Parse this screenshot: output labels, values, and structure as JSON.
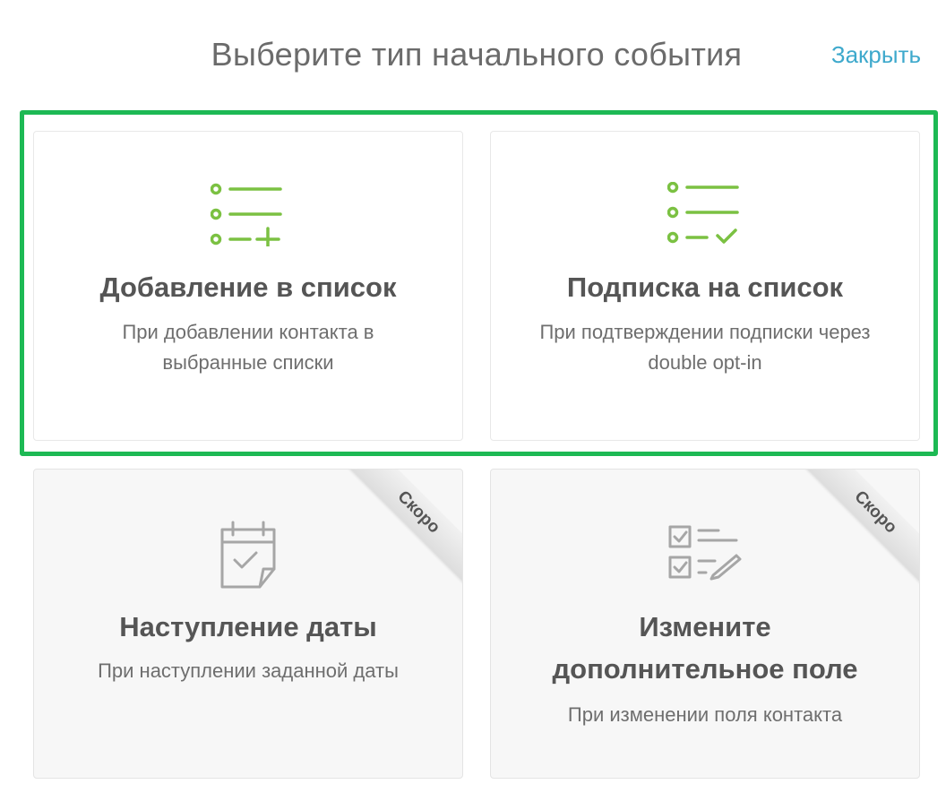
{
  "header": {
    "title": "Выберите тип начального события",
    "close_label": "Закрыть"
  },
  "colors": {
    "accent_green": "#1db954",
    "icon_green": "#7bc142",
    "link_blue": "#3ea9cc",
    "disabled_icon": "#a6a6a6"
  },
  "cards": [
    {
      "title": "Добавление в список",
      "description": "При добавлении контакта в выбранные списки",
      "icon": "list-add-icon",
      "enabled": true
    },
    {
      "title": "Подписка на список",
      "description": "При подтверждении подписки через double opt-in",
      "icon": "list-check-icon",
      "enabled": true
    },
    {
      "title": "Наступление даты",
      "description": "При наступлении заданной даты",
      "icon": "calendar-check-icon",
      "enabled": false,
      "badge": "Скоро"
    },
    {
      "title": "Измените дополнительное поле",
      "description": "При изменении поля контакта",
      "icon": "checklist-edit-icon",
      "enabled": false,
      "badge": "Скоро"
    }
  ]
}
